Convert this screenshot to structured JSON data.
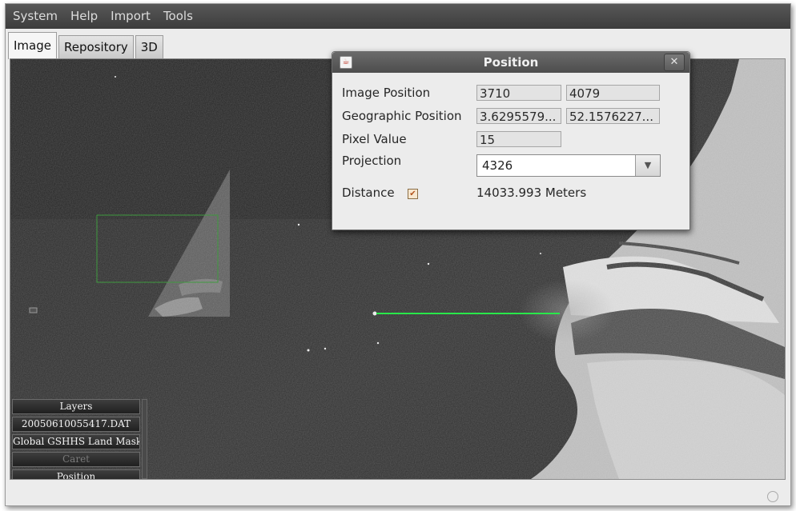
{
  "menubar": {
    "items": [
      "System",
      "Help",
      "Import",
      "Tools"
    ]
  },
  "tabs": [
    {
      "label": "Image",
      "active": true
    },
    {
      "label": "Repository",
      "active": false
    },
    {
      "label": "3D",
      "active": false
    }
  ],
  "layers": {
    "items": [
      {
        "label": "Layers",
        "enabled": true
      },
      {
        "label": "20050610055417.DAT",
        "enabled": true
      },
      {
        "label": "Global GSHHS Land Mask",
        "enabled": true
      },
      {
        "label": "Caret",
        "enabled": false
      },
      {
        "label": "Position",
        "enabled": true
      }
    ]
  },
  "dialog": {
    "title": "Position",
    "close_glyph": "✕",
    "icon": "java-cup-icon",
    "image_position": {
      "label": "Image Position",
      "x": "3710",
      "y": "4079"
    },
    "geo_position": {
      "label": "Geographic Position",
      "lon": "3.6295579...",
      "lat": "52.1576227..."
    },
    "pixel_value": {
      "label": "Pixel Value",
      "value": "15"
    },
    "projection": {
      "label": "Projection",
      "value": "4326",
      "arrow": "▼"
    },
    "distance": {
      "label": "Distance",
      "checked": true,
      "check_glyph": "✔",
      "value": "14033.993 Meters"
    }
  },
  "colors": {
    "measure_line": "#29e84a",
    "selection_box": "#3f9a3f",
    "menubar": "#4a4a4a",
    "dialog_bg": "#ececec"
  }
}
